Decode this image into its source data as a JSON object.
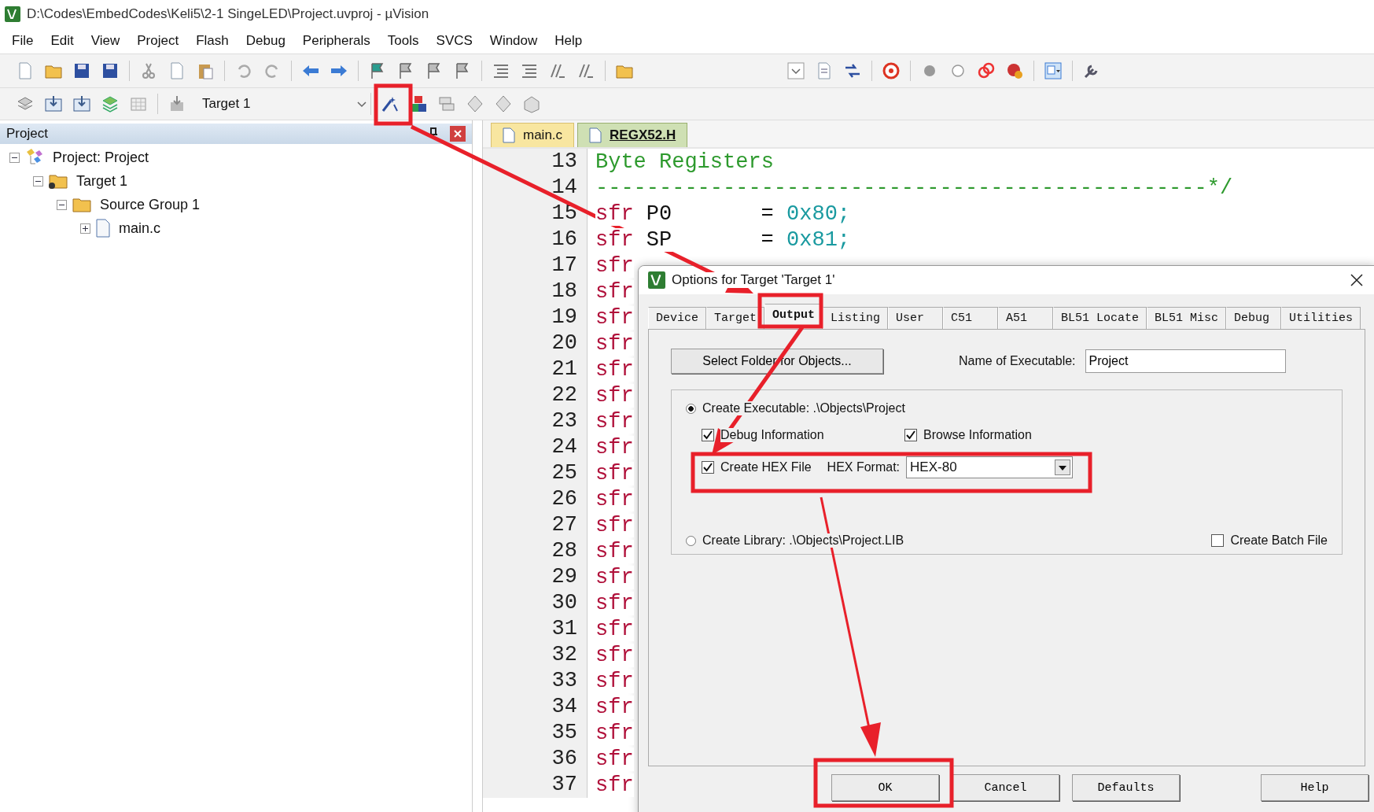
{
  "window": {
    "title": "D:\\Codes\\EmbedCodes\\Keli5\\2-1 SingeLED\\Project.uvproj - µVision"
  },
  "menu": [
    "File",
    "Edit",
    "View",
    "Project",
    "Flash",
    "Debug",
    "Peripherals",
    "Tools",
    "SVCS",
    "Window",
    "Help"
  ],
  "toolbar": {
    "target": "Target 1"
  },
  "project_panel": {
    "title": "Project",
    "tree": [
      {
        "label": "Project: Project",
        "kind": "project",
        "expanded": true,
        "children": [
          {
            "label": "Target 1",
            "kind": "target",
            "expanded": true,
            "children": [
              {
                "label": "Source Group 1",
                "kind": "group",
                "expanded": true,
                "children": [
                  {
                    "label": "main.c",
                    "kind": "file",
                    "expanded": false
                  }
                ]
              }
            ]
          }
        ]
      }
    ]
  },
  "editor": {
    "tabs": [
      {
        "label": "main.c",
        "selected": false
      },
      {
        "label": "REGX52.H",
        "selected": true
      }
    ],
    "lines": [
      {
        "number": "13",
        "kind": "comment",
        "text": "Byte Registers"
      },
      {
        "number": "14",
        "kind": "comment",
        "text": "------------------------------------------------*/"
      },
      {
        "number": "15",
        "kind": "sfr",
        "keyword": "sfr",
        "name": "P0       = ",
        "value": "0x80;"
      },
      {
        "number": "16",
        "kind": "sfr",
        "keyword": "sfr",
        "name": "SP       = ",
        "value": "0x81;"
      },
      {
        "number": "17",
        "kind": "sfr",
        "keyword": "sfr"
      },
      {
        "number": "18",
        "kind": "sfr",
        "keyword": "sfr"
      },
      {
        "number": "19",
        "kind": "sfr",
        "keyword": "sfr"
      },
      {
        "number": "20",
        "kind": "sfr",
        "keyword": "sfr"
      },
      {
        "number": "21",
        "kind": "sfr",
        "keyword": "sfr"
      },
      {
        "number": "22",
        "kind": "sfr",
        "keyword": "sfr"
      },
      {
        "number": "23",
        "kind": "sfr",
        "keyword": "sfr"
      },
      {
        "number": "24",
        "kind": "sfr",
        "keyword": "sfr"
      },
      {
        "number": "25",
        "kind": "sfr",
        "keyword": "sfr"
      },
      {
        "number": "26",
        "kind": "sfr",
        "keyword": "sfr"
      },
      {
        "number": "27",
        "kind": "sfr",
        "keyword": "sfr"
      },
      {
        "number": "28",
        "kind": "sfr",
        "keyword": "sfr"
      },
      {
        "number": "29",
        "kind": "sfr",
        "keyword": "sfr"
      },
      {
        "number": "30",
        "kind": "sfr",
        "keyword": "sfr"
      },
      {
        "number": "31",
        "kind": "sfr",
        "keyword": "sfr"
      },
      {
        "number": "32",
        "kind": "sfr",
        "keyword": "sfr"
      },
      {
        "number": "33",
        "kind": "sfr",
        "keyword": "sfr"
      },
      {
        "number": "34",
        "kind": "sfr",
        "keyword": "sfr"
      },
      {
        "number": "35",
        "kind": "sfr",
        "keyword": "sfr"
      },
      {
        "number": "36",
        "kind": "sfr",
        "keyword": "sfr"
      },
      {
        "number": "37",
        "kind": "sfr",
        "keyword": "sfr"
      }
    ]
  },
  "dialog": {
    "title": "Options for Target 'Target 1'",
    "tabs": [
      {
        "label": "Device",
        "selected": false
      },
      {
        "label": "Target",
        "selected": false
      },
      {
        "label": "Output",
        "selected": true
      },
      {
        "label": "Listing",
        "selected": false
      },
      {
        "label": "User",
        "selected": false
      },
      {
        "label": "C51",
        "selected": false
      },
      {
        "label": "A51",
        "selected": false
      },
      {
        "label": "BL51 Locate",
        "selected": false
      },
      {
        "label": "BL51 Misc",
        "selected": false
      },
      {
        "label": "Debug",
        "selected": false
      },
      {
        "label": "Utilities",
        "selected": false
      }
    ],
    "select_folder_button": "Select Folder for Objects...",
    "name_label": "Name of Executable:",
    "name_value": "Project",
    "output_type": [
      {
        "label": "Create Executable:  .\\Objects\\Project",
        "selected": true
      },
      {
        "label": "Create Library:  .\\Objects\\Project.LIB",
        "selected": false
      }
    ],
    "options": [
      {
        "label": "Debug Information",
        "checked": true
      },
      {
        "label": "Browse Information",
        "checked": true
      }
    ],
    "hex": {
      "label": "Create HEX File",
      "checked": true,
      "format_label": "HEX Format:",
      "format_value": "HEX-80"
    },
    "batch": {
      "label": "Create Batch File",
      "checked": false
    },
    "buttons": [
      "OK",
      "Cancel",
      "Defaults",
      "Help"
    ]
  }
}
